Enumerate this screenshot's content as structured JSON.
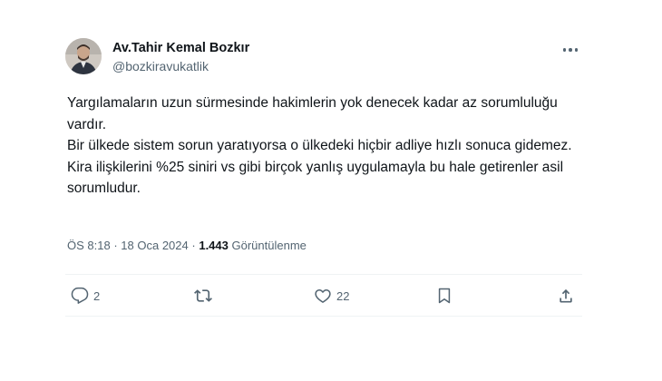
{
  "tweet": {
    "author": {
      "display_name": "Av.Tahir Kemal Bozkır",
      "handle": "@bozkiravukatlik"
    },
    "text_lines": [
      "Yargılamaların uzun sürmesinde hakimlerin yok denecek kadar az sorumluluğu vardır.",
      "Bir ülkede sistem sorun yaratıyorsa o ülkedeki hiçbir adliye hızlı sonuca gidemez.",
      "Kira ilişkilerini %25 siniri vs gibi birçok yanlış uygulamayla bu hale getirenler asil sorumludur."
    ],
    "meta": {
      "time": "ÖS 8:18",
      "dot1": "·",
      "date": "18 Oca 2024",
      "dot2": "·",
      "views_count": "1.443",
      "views_label": "Görüntülenme"
    },
    "actions": {
      "reply_count": "2",
      "like_count": "22"
    }
  },
  "colors": {
    "text_primary": "#0f1419",
    "text_secondary": "#536471",
    "divider": "#eff3f4"
  },
  "icons": [
    "more-icon",
    "reply-icon",
    "retweet-icon",
    "like-icon",
    "bookmark-icon",
    "share-icon"
  ]
}
